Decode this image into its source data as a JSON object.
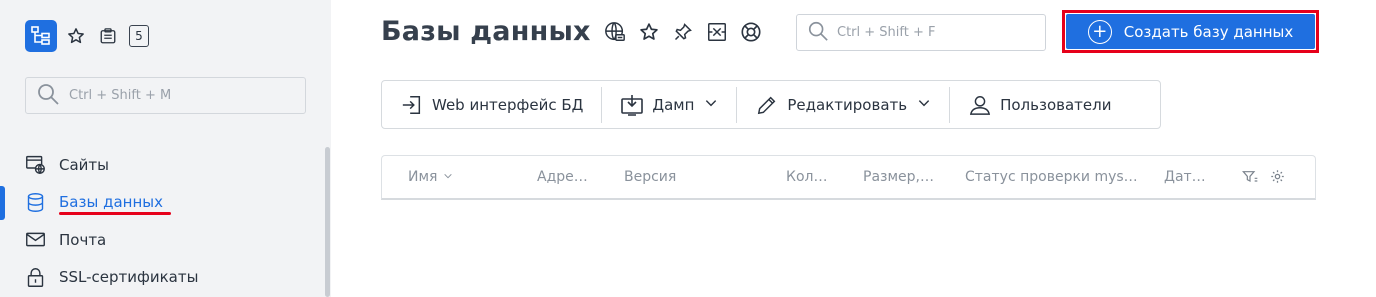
{
  "sidebar": {
    "top_icons": [
      "tree-logo-icon",
      "star-icon",
      "clipboard-icon"
    ],
    "counter": "5",
    "search": {
      "placeholder": "Ctrl + Shift + M"
    },
    "items": [
      {
        "label": "Сайты",
        "icon": "sites-icon",
        "active": false
      },
      {
        "label": "Базы данных",
        "icon": "database-icon",
        "active": true
      },
      {
        "label": "Почта",
        "icon": "mail-icon",
        "active": false
      },
      {
        "label": "SSL-сертификаты",
        "icon": "lock-icon",
        "active": false
      }
    ]
  },
  "header": {
    "title": "Базы данных",
    "title_icons": [
      "globe-icon",
      "star-icon",
      "pin-icon",
      "excel-icon",
      "help-lifebuoy-icon"
    ],
    "search": {
      "placeholder": "Ctrl + Shift + F"
    },
    "create_button": "Создать базу данных"
  },
  "toolbar": {
    "web_interface": "Web интерфейс БД",
    "dump": "Дамп",
    "edit": "Редактировать",
    "users": "Пользователи"
  },
  "table": {
    "columns": [
      "Имя",
      "Адре…",
      "Версия",
      "Кол…",
      "Размер,…",
      "Статус проверки mys…",
      "Дат…"
    ]
  },
  "colors": {
    "accent": "#1f6fe0",
    "highlight": "#e6001a",
    "sidebar_bg": "#f2f3f5"
  }
}
